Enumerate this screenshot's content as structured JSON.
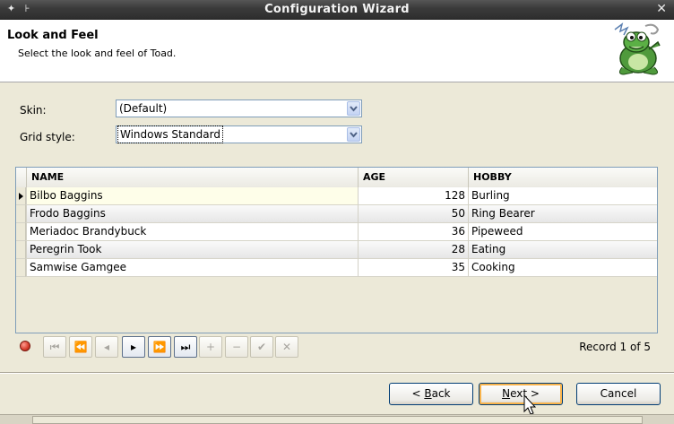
{
  "window": {
    "title": "Configuration Wizard",
    "left_buttons": [
      "✦",
      "⊦"
    ],
    "close_glyph": "✕"
  },
  "header": {
    "title": "Look and Feel",
    "subtitle": "Select the look and feel of Toad.",
    "logo_icon": "toad-frog-logo-icon"
  },
  "form": {
    "skin_label": "Skin:",
    "skin_value": "(Default)",
    "grid_style_label": "Grid style:",
    "grid_style_value": "Windows Standard"
  },
  "grid": {
    "columns": [
      "NAME",
      "AGE",
      "HOBBY"
    ],
    "rows": [
      {
        "name": "Bilbo Baggins",
        "age": "128",
        "hobby": "Burling"
      },
      {
        "name": "Frodo Baggins",
        "age": "50",
        "hobby": "Ring Bearer"
      },
      {
        "name": "Meriadoc Brandybuck",
        "age": "36",
        "hobby": "Pipeweed"
      },
      {
        "name": "Peregrin Took",
        "age": "28",
        "hobby": "Eating"
      },
      {
        "name": "Samwise Gamgee",
        "age": "35",
        "hobby": "Cooking"
      }
    ],
    "current_row_index": 0
  },
  "navigator": {
    "buttons": [
      {
        "name": "first-record-button",
        "glyph": "⏮",
        "enabled": false
      },
      {
        "name": "prev-page-button",
        "glyph": "⏪",
        "enabled": false
      },
      {
        "name": "prev-record-button",
        "glyph": "◂",
        "enabled": false
      },
      {
        "name": "next-record-button",
        "glyph": "▸",
        "enabled": true
      },
      {
        "name": "next-page-button",
        "glyph": "⏩",
        "enabled": true
      },
      {
        "name": "last-record-button",
        "glyph": "⏭",
        "enabled": true
      },
      {
        "name": "insert-record-button",
        "glyph": "+",
        "enabled": false
      },
      {
        "name": "delete-record-button",
        "glyph": "−",
        "enabled": false
      },
      {
        "name": "post-edit-button",
        "glyph": "✔",
        "enabled": false
      },
      {
        "name": "cancel-edit-button",
        "glyph": "✕",
        "enabled": false
      }
    ],
    "record_text": "Record 1 of 5"
  },
  "footer": {
    "back_prefix": "< ",
    "back_key": "B",
    "back_rest": "ack",
    "next_key": "N",
    "next_rest": "ext >",
    "cancel_label": "Cancel"
  },
  "colors": {
    "window_bg": "#ece9d8",
    "titlebar": "#3a3a3a",
    "current_row": "#fefee9",
    "border_blue": "#7f9db9"
  }
}
